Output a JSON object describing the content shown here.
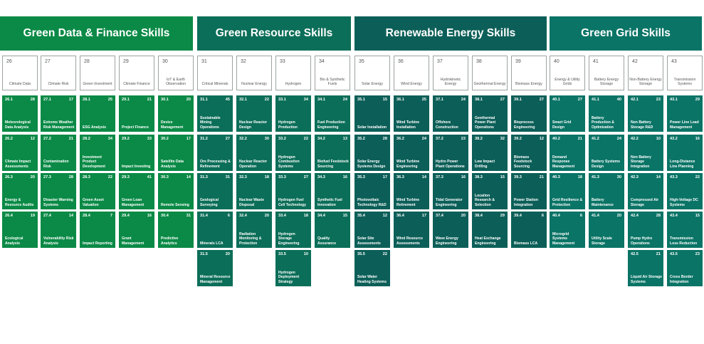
{
  "colors": {
    "finance": "#0a8a46",
    "resource": "#0b6e58",
    "renewable": "#0c5f58",
    "grid": "#0a7466"
  },
  "groups": [
    {
      "title": "Green Data & Finance Skills",
      "color": "#0a8a46",
      "columns": [
        {
          "num": "26",
          "name": "Climate Data",
          "items": [
            {
              "id": "26.1",
              "count": "28",
              "label": "Meteorological Data Analysis"
            },
            {
              "id": "26.2",
              "count": "12",
              "label": "Climate Impact Assessments"
            },
            {
              "id": "26.3",
              "count": "20",
              "label": "Energy & Resource Audits"
            },
            {
              "id": "26.4",
              "count": "19",
              "label": "Ecological Analysis"
            }
          ]
        },
        {
          "num": "27",
          "name": "Climate Risk",
          "items": [
            {
              "id": "27.1",
              "count": "17",
              "label": "Extreme Weather Risk Management"
            },
            {
              "id": "27.2",
              "count": "21",
              "label": "Contamination Risk"
            },
            {
              "id": "27.3",
              "count": "28",
              "label": "Disaster Warning Systems"
            },
            {
              "id": "27.4",
              "count": "14",
              "label": "Vulnerability Risk Analysis"
            }
          ]
        },
        {
          "num": "28",
          "name": "Green Investment",
          "items": [
            {
              "id": "28.1",
              "count": "25",
              "label": "ESG Analysis"
            },
            {
              "id": "28.2",
              "count": "34",
              "label": "Investment Product Development"
            },
            {
              "id": "28.3",
              "count": "22",
              "label": "Green Asset Valuation"
            },
            {
              "id": "28.4",
              "count": "7",
              "label": "Impact Reporting"
            }
          ]
        },
        {
          "num": "29",
          "name": "Climate Finance",
          "items": [
            {
              "id": "29.1",
              "count": "21",
              "label": "Project Finance"
            },
            {
              "id": "29.2",
              "count": "33",
              "label": "Impact Investing"
            },
            {
              "id": "29.3",
              "count": "41",
              "label": "Green Loan Management"
            },
            {
              "id": "29.4",
              "count": "16",
              "label": "Grant Management"
            }
          ]
        },
        {
          "num": "30",
          "name": "IoT & Earth Observation",
          "items": [
            {
              "id": "30.1",
              "count": "20",
              "label": "Device Management"
            },
            {
              "id": "30.2",
              "count": "17",
              "label": "Satellite Data Analysis"
            },
            {
              "id": "30.3",
              "count": "14",
              "label": "Remote Sensing"
            },
            {
              "id": "30.4",
              "count": "31",
              "label": "Predictive Analytics"
            }
          ]
        }
      ]
    },
    {
      "title": "Green Resource Skills",
      "color": "#0b6e58",
      "columns": [
        {
          "num": "31",
          "name": "Critical Minerals",
          "items": [
            {
              "id": "31.1",
              "count": "45",
              "label": "Sustainable Mining Operations"
            },
            {
              "id": "31.2",
              "count": "27",
              "label": "Ore Processing & Refinement"
            },
            {
              "id": "31.3",
              "count": "31",
              "label": "Geological Surveying"
            },
            {
              "id": "31.4",
              "count": "6",
              "label": "Minerals LCA"
            },
            {
              "id": "31.5",
              "count": "20",
              "label": "Mineral Resource Management"
            }
          ]
        },
        {
          "num": "32",
          "name": "Nuclear Energy",
          "items": [
            {
              "id": "32.1",
              "count": "22",
              "label": "Nuclear Reactor Design"
            },
            {
              "id": "32.2",
              "count": "30",
              "label": "Nuclear Reactor Operation"
            },
            {
              "id": "32.3",
              "count": "18",
              "label": "Nuclear Waste Disposal"
            },
            {
              "id": "32.4",
              "count": "20",
              "label": "Radiation Monitoring & Protection"
            }
          ]
        },
        {
          "num": "33",
          "name": "Hydrogen",
          "items": [
            {
              "id": "33.1",
              "count": "34",
              "label": "Hydrogen Production"
            },
            {
              "id": "33.2",
              "count": "22",
              "label": "Hydrogen Combustion Systems"
            },
            {
              "id": "33.3",
              "count": "27",
              "label": "Hydrogen Fuel Cell Technology"
            },
            {
              "id": "33.4",
              "count": "18",
              "label": "Hydrogen Storage Engineering"
            },
            {
              "id": "33.5",
              "count": "10",
              "label": "Hydrogen Deployment Strategy"
            }
          ]
        },
        {
          "num": "34",
          "name": "Bio & Synthetic Fuels",
          "items": [
            {
              "id": "34.1",
              "count": "24",
              "label": "Fuel Production Engineering"
            },
            {
              "id": "34.2",
              "count": "13",
              "label": "Biofuel Feedstock Sourcing"
            },
            {
              "id": "34.3",
              "count": "16",
              "label": "Synthetic Fuel Innovation"
            },
            {
              "id": "34.4",
              "count": "15",
              "label": "Quality Assurance"
            }
          ]
        }
      ]
    },
    {
      "title": "Renewable Energy Skills",
      "color": "#0c5f58",
      "columns": [
        {
          "num": "35",
          "name": "Solar Energy",
          "items": [
            {
              "id": "35.1",
              "count": "15",
              "label": "Solar Installation"
            },
            {
              "id": "35.2",
              "count": "28",
              "label": "Solar Energy Systems Design"
            },
            {
              "id": "35.3",
              "count": "17",
              "label": "Photovoltaic Technology R&D"
            },
            {
              "id": "35.4",
              "count": "12",
              "label": "Solar Site Assessments"
            },
            {
              "id": "35.5",
              "count": "22",
              "label": "Solar Water Heating Systems"
            }
          ]
        },
        {
          "num": "36",
          "name": "Wind Energy",
          "items": [
            {
              "id": "36.1",
              "count": "25",
              "label": "Wind Turbine Installation"
            },
            {
              "id": "36.2",
              "count": "24",
              "label": "Wind Turbine Engineering"
            },
            {
              "id": "36.3",
              "count": "14",
              "label": "Wind Turbine Retirement"
            },
            {
              "id": "36.4",
              "count": "17",
              "label": "Wind Resource Assessments"
            }
          ]
        },
        {
          "num": "37",
          "name": "Hydrokinetic Energy",
          "items": [
            {
              "id": "37.1",
              "count": "24",
              "label": "Offshore Construction"
            },
            {
              "id": "37.2",
              "count": "23",
              "label": "Hydro Power Plant Operations"
            },
            {
              "id": "37.3",
              "count": "16",
              "label": "Tidal Generator Engineering"
            },
            {
              "id": "37.4",
              "count": "20",
              "label": "Wave Energy Engineering"
            }
          ]
        },
        {
          "num": "38",
          "name": "Geothermal Energy",
          "items": [
            {
              "id": "38.1",
              "count": "27",
              "label": "Geothermal Power Plant Operations"
            },
            {
              "id": "38.2",
              "count": "32",
              "label": "Low Impact Drilling"
            },
            {
              "id": "38.3",
              "count": "15",
              "label": "Location Research & Selection"
            },
            {
              "id": "38.4",
              "count": "29",
              "label": "Heat Exchange Engineering"
            }
          ]
        },
        {
          "num": "39",
          "name": "Biomass Energy",
          "items": [
            {
              "id": "39.1",
              "count": "27",
              "label": "Bioprocess Engineering"
            },
            {
              "id": "39.2",
              "count": "12",
              "label": "Biomass Feedstock Sourcing"
            },
            {
              "id": "39.3",
              "count": "21",
              "label": "Power Station Integration"
            },
            {
              "id": "39.4",
              "count": "6",
              "label": "Biomass LCA"
            }
          ]
        }
      ]
    },
    {
      "title": "Green Grid Skills",
      "color": "#0a7466",
      "columns": [
        {
          "num": "40",
          "name": "Energy & Utility Grids",
          "items": [
            {
              "id": "40.1",
              "count": "27",
              "label": "Smart Grid Design"
            },
            {
              "id": "40.2",
              "count": "21",
              "label": "Demand Response Management"
            },
            {
              "id": "40.3",
              "count": "18",
              "label": "Grid Resilience & Protection"
            },
            {
              "id": "40.4",
              "count": "6",
              "label": "Microgrid Systems Management"
            }
          ]
        },
        {
          "num": "41",
          "name": "Battery Energy Storage",
          "items": [
            {
              "id": "41.1",
              "count": "40",
              "label": "Battery Production & Optimization"
            },
            {
              "id": "41.2",
              "count": "24",
              "label": "Battery Systems Design"
            },
            {
              "id": "41.3",
              "count": "30",
              "label": "Battery Maintenance"
            },
            {
              "id": "41.4",
              "count": "20",
              "label": "Utility Scale Storage"
            }
          ]
        },
        {
          "num": "42",
          "name": "Non-Battery Energy Storage",
          "items": [
            {
              "id": "42.1",
              "count": "23",
              "label": "Non Battery Storage R&D"
            },
            {
              "id": "42.2",
              "count": "10",
              "label": "Non Battery Storage Integration"
            },
            {
              "id": "42.3",
              "count": "14",
              "label": "Compressed Air Storage"
            },
            {
              "id": "42.4",
              "count": "28",
              "label": "Pump Hydro Operations"
            },
            {
              "id": "42.5",
              "count": "21",
              "label": "Liquid Air Storage Systems"
            }
          ]
        },
        {
          "num": "43",
          "name": "Transmission Systems",
          "items": [
            {
              "id": "43.1",
              "count": "29",
              "label": "Power Line Load Management"
            },
            {
              "id": "43.2",
              "count": "16",
              "label": "Long-Distance Line Planning"
            },
            {
              "id": "43.3",
              "count": "22",
              "label": "High-Voltage DC Systems"
            },
            {
              "id": "43.4",
              "count": "15",
              "label": "Transmission Loss Reduction"
            },
            {
              "id": "43.5",
              "count": "23",
              "label": "Cross Border Integration"
            }
          ]
        }
      ]
    }
  ]
}
